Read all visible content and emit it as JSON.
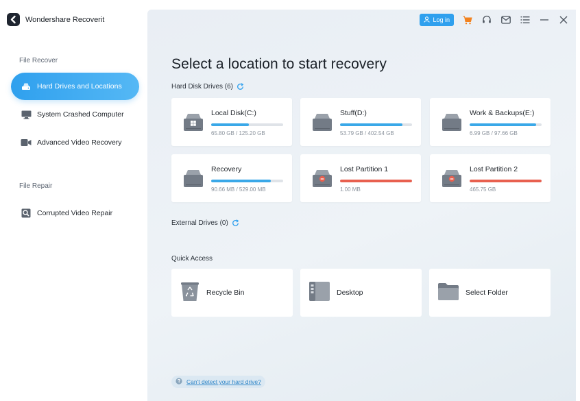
{
  "app": {
    "title": "Wondershare Recoverit"
  },
  "sidebar": {
    "file_recover_label": "File Recover",
    "items": [
      {
        "label": "Hard Drives and Locations",
        "icon": "hard-drive-icon",
        "active": true
      },
      {
        "label": "System Crashed Computer",
        "icon": "monitor-icon",
        "active": false
      },
      {
        "label": "Advanced Video Recovery",
        "icon": "video-camera-icon",
        "active": false
      }
    ],
    "file_repair_label": "File Repair",
    "repair_items": [
      {
        "label": "Corrupted Video Repair",
        "icon": "video-repair-icon"
      }
    ]
  },
  "topbar": {
    "login_label": "Log in",
    "icons": [
      "cart-icon",
      "headset-icon",
      "mail-icon",
      "menu-icon",
      "minimize-icon",
      "close-icon"
    ]
  },
  "main": {
    "title": "Select a location to start recovery",
    "hard_disk_label": "Hard Disk Drives (6)",
    "drives": [
      {
        "name": "Local Disk(C:)",
        "size": "65.80 GB / 125.20 GB",
        "fill": 0.525,
        "color": "#3aa8e8",
        "type": "windows"
      },
      {
        "name": "Stuff(D:)",
        "size": "53.79 GB / 402.54 GB",
        "fill": 0.87,
        "color": "#3aa8e8",
        "type": "disk"
      },
      {
        "name": "Work & Backups(E:)",
        "size": "6.99 GB / 97.66 GB",
        "fill": 0.92,
        "color": "#3aa8e8",
        "type": "disk"
      },
      {
        "name": "Recovery",
        "size": "90.66 MB / 529.00 MB",
        "fill": 0.83,
        "color": "#3aa8e8",
        "type": "disk"
      },
      {
        "name": "Lost Partition 1",
        "size": "1.00 MB",
        "fill": 1.0,
        "color": "#e8604f",
        "type": "lost"
      },
      {
        "name": "Lost Partition 2",
        "size": "465.75 GB",
        "fill": 1.0,
        "color": "#e8604f",
        "type": "lost"
      }
    ],
    "external_label": "External Drives (0)",
    "quick_access_label": "Quick Access",
    "quick_access": [
      {
        "label": "Recycle Bin",
        "icon": "recycle-bin-icon"
      },
      {
        "label": "Desktop",
        "icon": "desktop-icon"
      },
      {
        "label": "Select Folder",
        "icon": "folder-icon"
      }
    ],
    "help_text": "Can't detect your hard drive?"
  },
  "colors": {
    "accent": "#2fa0ee",
    "danger": "#e8604f",
    "bar_track": "#dfe3e8"
  }
}
